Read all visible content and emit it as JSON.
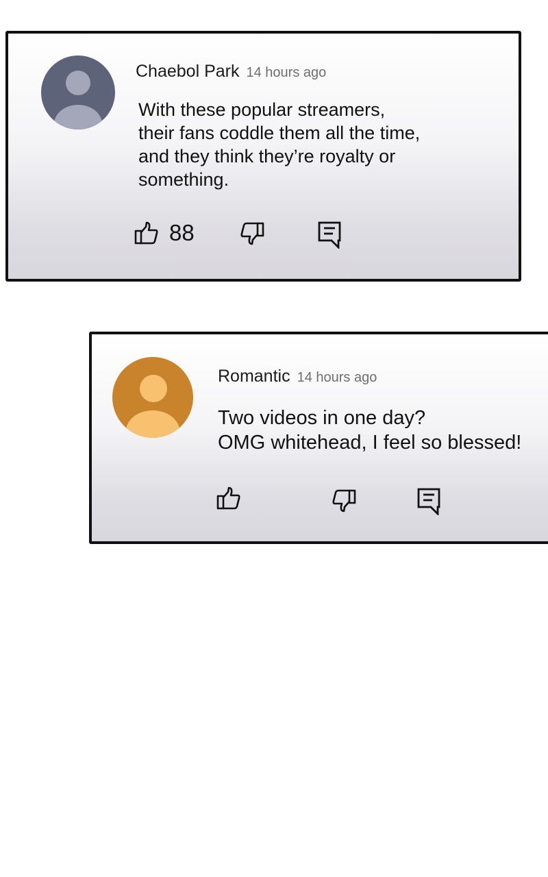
{
  "comments": [
    {
      "author": "Chaebol Park",
      "time": "14 hours ago",
      "lines": [
        "With these popular streamers,",
        "their fans coddle them all the time,",
        "and they think they’re royalty or",
        "something."
      ],
      "likes": "88",
      "avatar_color": "#5d6379",
      "avatar_figure_color": "#a4a7ba"
    },
    {
      "author": "Romantic",
      "time": "14 hours ago",
      "lines": [
        "Two videos in one day?",
        "OMG whitehead, I feel so blessed!"
      ],
      "likes": "",
      "avatar_color": "#c8832b",
      "avatar_figure_color": "#f8c16f"
    }
  ],
  "icons": {
    "like": "thumbs-up-icon",
    "dislike": "thumbs-down-icon",
    "reply": "reply-comment-icon"
  }
}
